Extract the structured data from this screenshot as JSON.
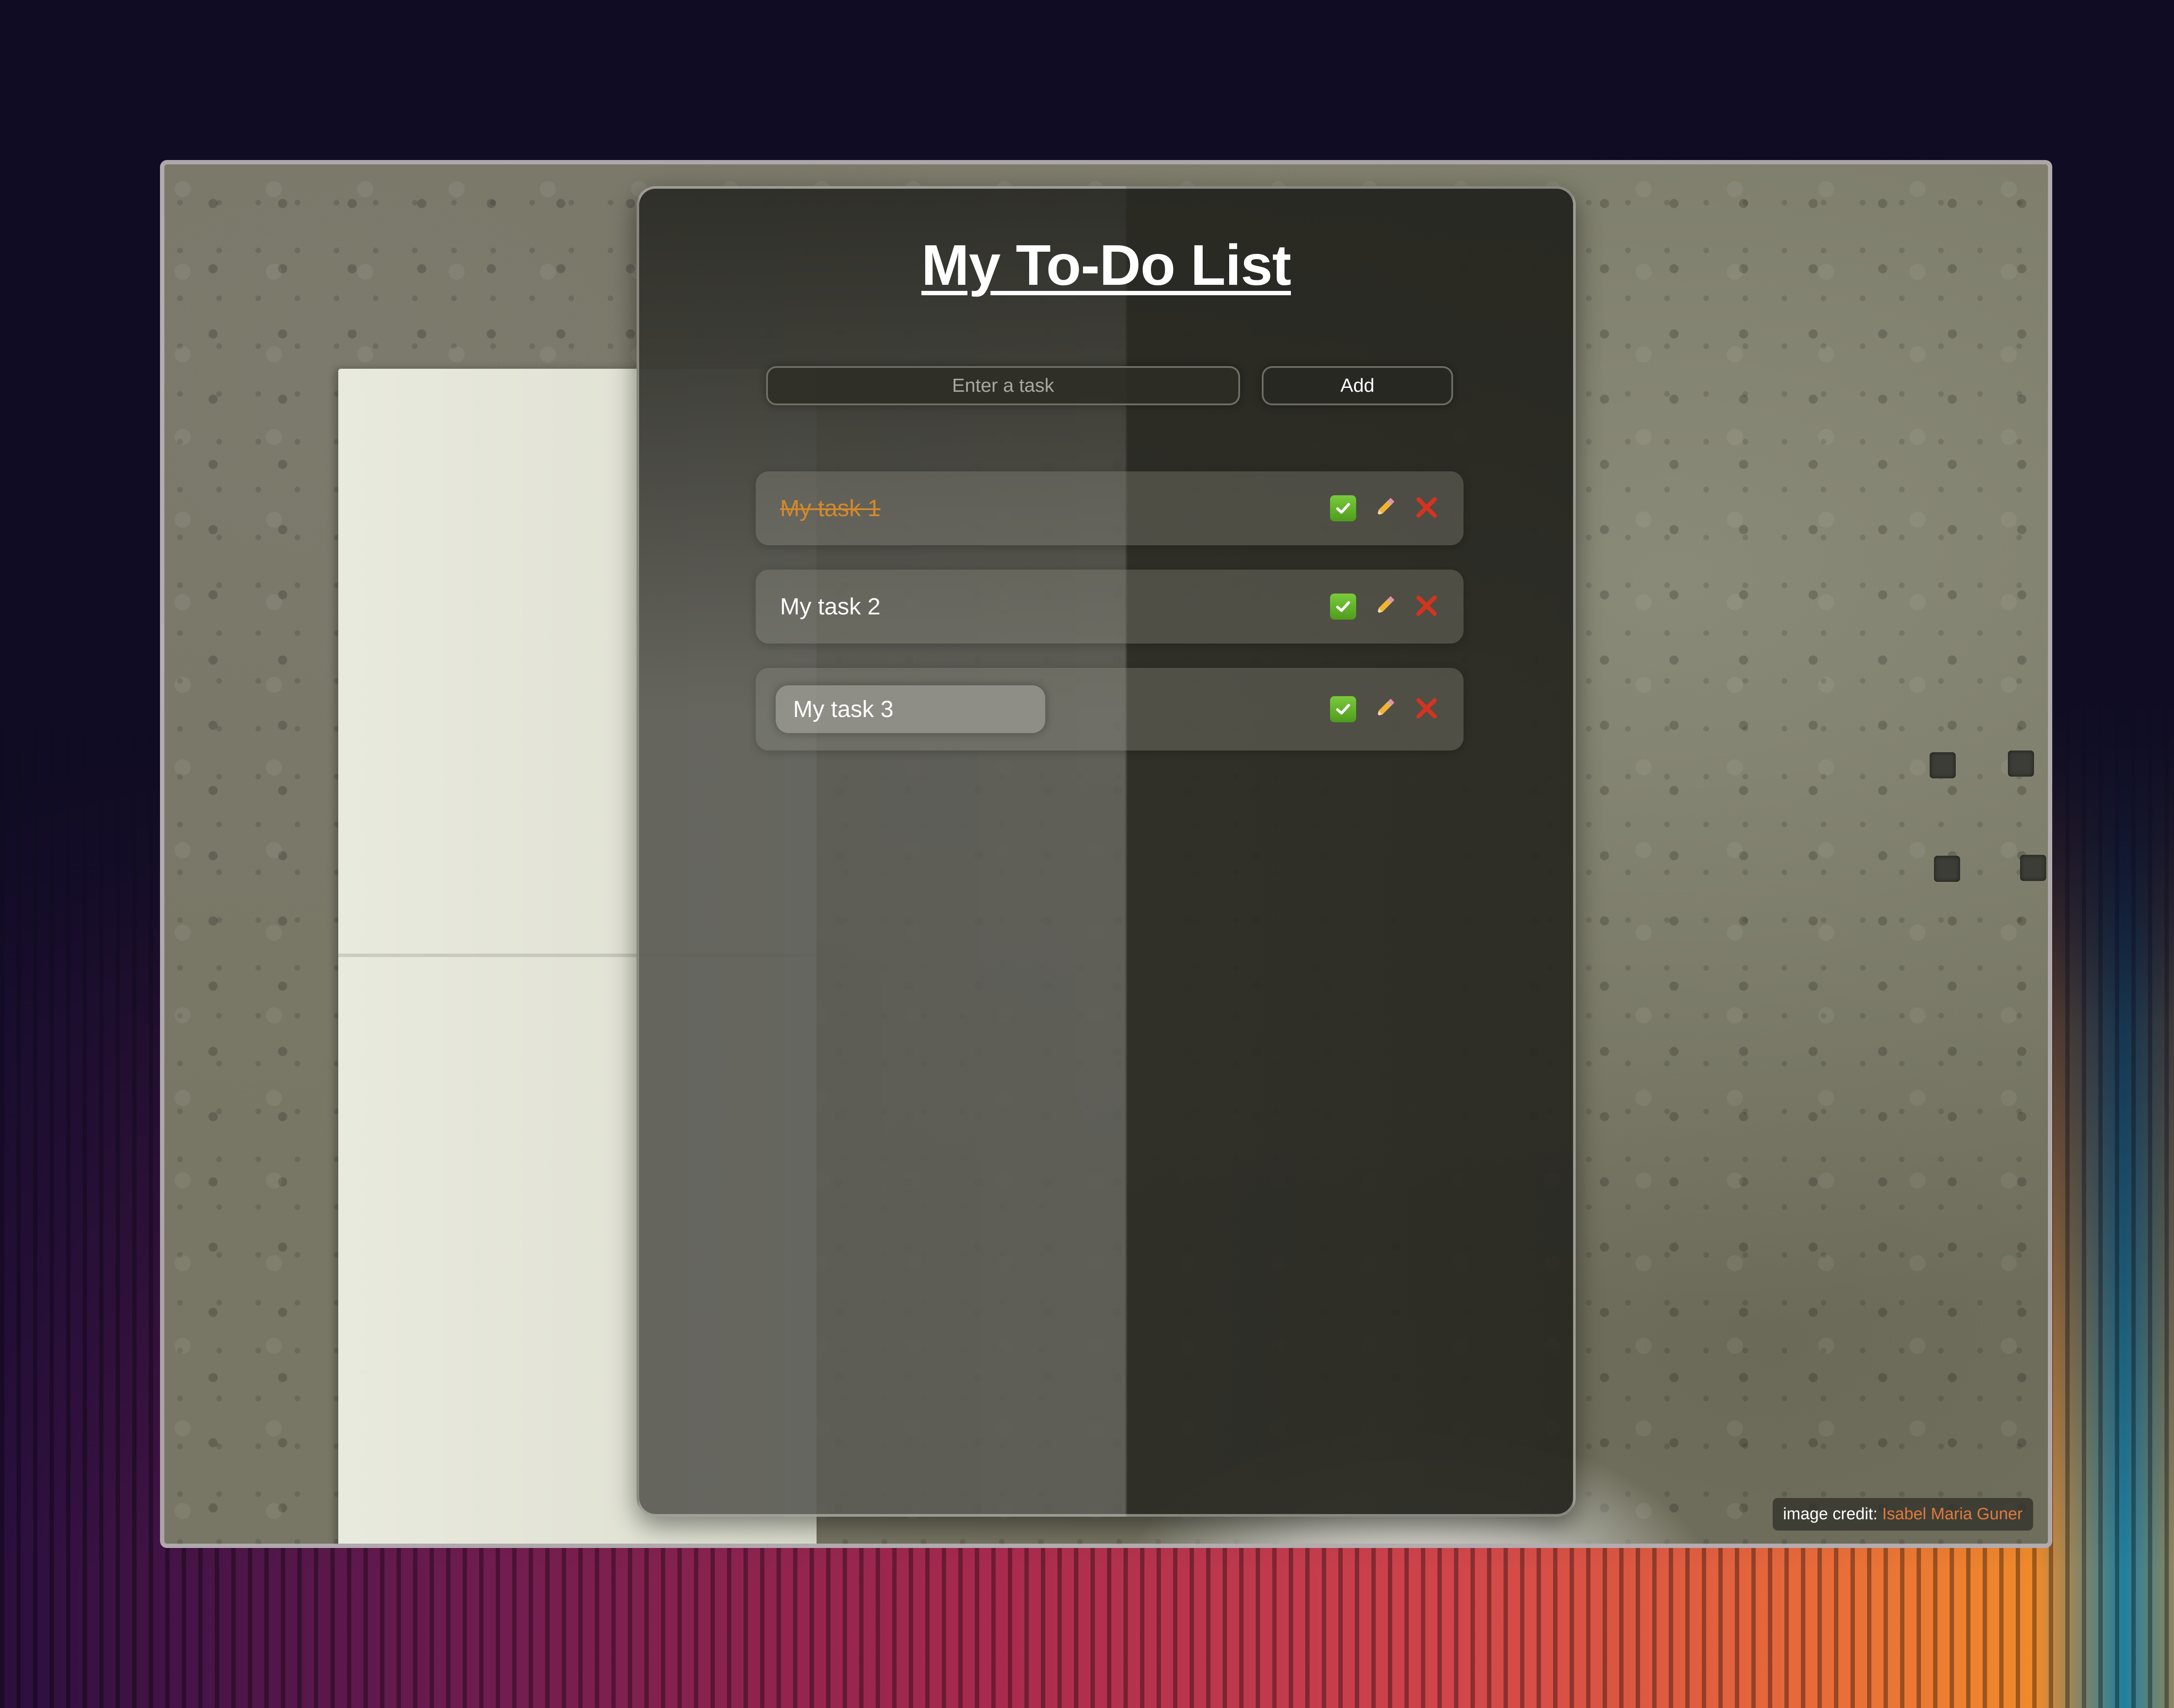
{
  "app": {
    "title": "My To-Do List"
  },
  "form": {
    "input_placeholder": "Enter a task",
    "add_label": "Add"
  },
  "tasks": [
    {
      "text": "My task 1",
      "completed": true,
      "editing": false
    },
    {
      "text": "My task 2",
      "completed": false,
      "editing": false
    },
    {
      "text": "My task 3",
      "completed": false,
      "editing": true
    }
  ],
  "icons": {
    "complete": "check-icon",
    "edit": "pencil-icon",
    "delete": "cross-icon"
  },
  "credit": {
    "label": "image credit:",
    "author": "Isabel Maria Guner"
  },
  "colors": {
    "done_text": "#d4892b",
    "credit_link": "#e07a3c",
    "check_green": "#5fb02a",
    "delete_red": "#d6331f"
  }
}
